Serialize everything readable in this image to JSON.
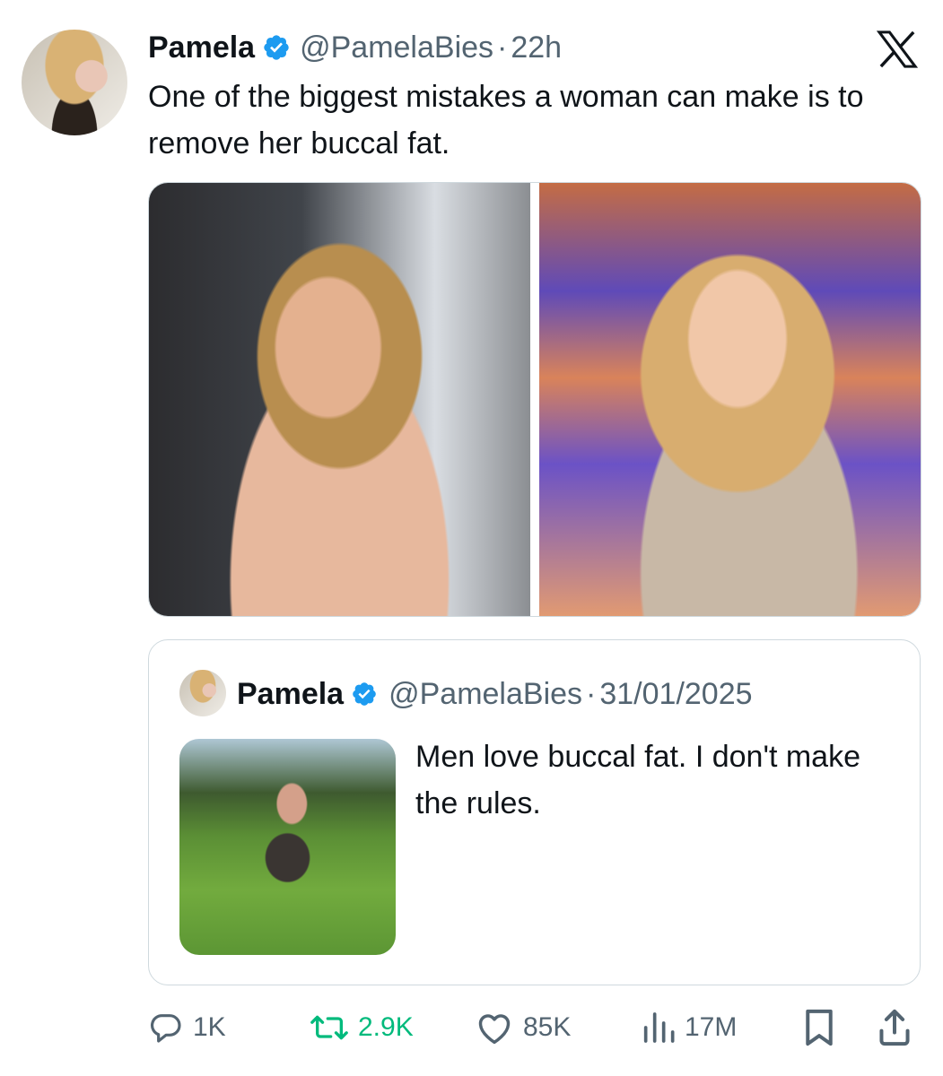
{
  "tweet": {
    "author_name": "Pamela",
    "handle": "@PamelaBies",
    "separator": "·",
    "time": "22h",
    "text": "One of the biggest mistakes a woman can make is to remove her buccal fat."
  },
  "quoted_tweet": {
    "author_name": "Pamela",
    "handle": "@PamelaBies",
    "separator": "·",
    "date": "31/01/2025",
    "text": "Men love buccal fat. I don't make the rules."
  },
  "actions": {
    "replies": "1K",
    "reposts": "2.9K",
    "likes": "85K",
    "views": "17M"
  },
  "icons": {
    "reply": "reply-icon",
    "repost": "repost-icon",
    "like": "heart-icon",
    "views": "views-icon",
    "bookmark": "bookmark-icon",
    "share": "share-icon",
    "verified": "verified-badge-icon",
    "brand": "x-logo-icon"
  },
  "colors": {
    "verified": "#1d9bf0",
    "repost_active": "#00ba7c",
    "secondary_text": "#536471",
    "border": "#cfd9de"
  }
}
